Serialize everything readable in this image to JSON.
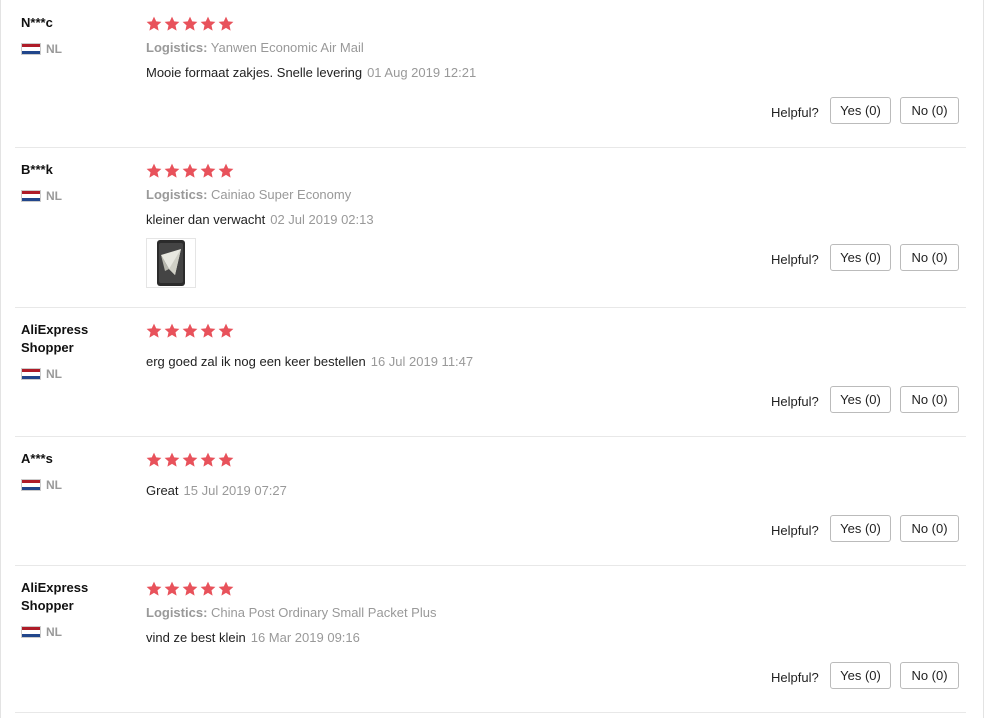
{
  "helpful_label": "Helpful?",
  "star_color": "#e8525b",
  "reviews": [
    {
      "user": "N***c",
      "country": "NL",
      "rating": 5,
      "logistics_label": "Logistics:",
      "logistics_value": "Yanwen Economic Air Mail",
      "text": "Mooie formaat zakjes. Snelle levering",
      "date": "01 Aug 2019 12:21",
      "yes": "Yes (0)",
      "no": "No (0)"
    },
    {
      "user": "B***k",
      "country": "NL",
      "rating": 5,
      "logistics_label": "Logistics:",
      "logistics_value": "Cainiao Super Economy",
      "text": "kleiner dan verwacht",
      "date": "02 Jul 2019 02:13",
      "photo_icon": "review-photo",
      "yes": "Yes (0)",
      "no": "No (0)"
    },
    {
      "user": "AliExpress Shopper",
      "country": "NL",
      "rating": 5,
      "text": "erg goed zal ik nog een keer bestellen",
      "date": "16 Jul 2019 11:47",
      "yes": "Yes (0)",
      "no": "No (0)"
    },
    {
      "user": "A***s",
      "country": "NL",
      "rating": 5,
      "text": "Great",
      "date": "15 Jul 2019 07:27",
      "yes": "Yes (0)",
      "no": "No (0)"
    },
    {
      "user": "AliExpress Shopper",
      "country": "NL",
      "rating": 5,
      "logistics_label": "Logistics:",
      "logistics_value": "China Post Ordinary Small Packet Plus",
      "text": "vind ze best klein",
      "date": "16 Mar 2019 09:16",
      "yes": "Yes (0)",
      "no": "No (0)"
    }
  ]
}
